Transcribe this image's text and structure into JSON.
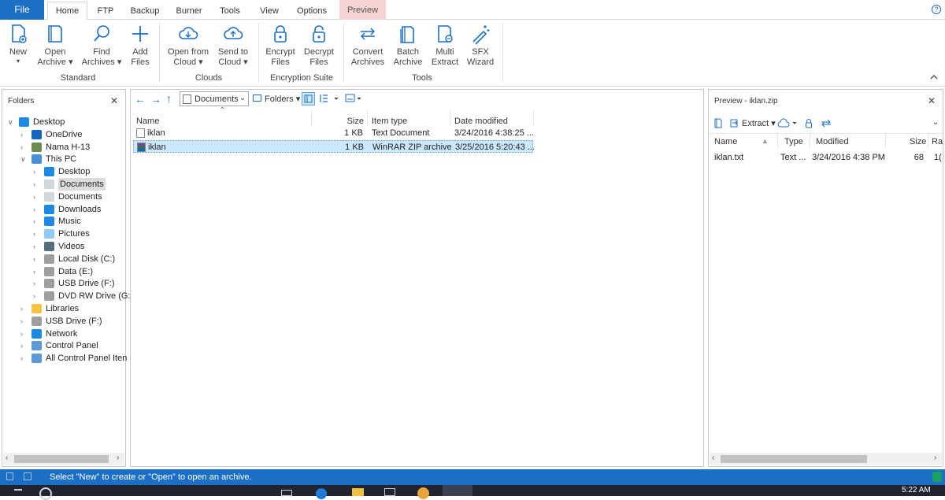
{
  "tabs": {
    "file": "File",
    "home": "Home",
    "ftp": "FTP",
    "backup": "Backup",
    "burner": "Burner",
    "tools": "Tools",
    "view": "View",
    "options": "Options",
    "preview": "Preview"
  },
  "help_icon": "?",
  "ribbon": {
    "new": {
      "line1": "New",
      "line2": "",
      "arrow": "▾"
    },
    "open_archive": {
      "line1": "Open",
      "line2": "Archive ▾"
    },
    "find_archives": {
      "line1": "Find",
      "line2": "Archives ▾"
    },
    "add_files": {
      "line1": "Add",
      "line2": "Files"
    },
    "open_from_cloud": {
      "line1": "Open from",
      "line2": "Cloud ▾"
    },
    "send_to_cloud": {
      "line1": "Send to",
      "line2": "Cloud ▾"
    },
    "encrypt_files": {
      "line1": "Encrypt",
      "line2": "Files"
    },
    "decrypt_files": {
      "line1": "Decrypt",
      "line2": "Files"
    },
    "convert_archives": {
      "line1": "Convert",
      "line2": "Archives"
    },
    "batch_archive": {
      "line1": "Batch",
      "line2": "Archive"
    },
    "multi_extract": {
      "line1": "Multi",
      "line2": "Extract"
    },
    "sfx_wizard": {
      "line1": "SFX",
      "line2": "Wizard"
    },
    "groups": {
      "standard": "Standard",
      "clouds": "Clouds",
      "encryption": "Encryption Suite",
      "tools": "Tools"
    }
  },
  "folders_panel": {
    "title": "Folders",
    "close": "✕",
    "tree": [
      {
        "label": "Desktop",
        "chev": "∨",
        "icon": "desktop-icon"
      },
      {
        "label": "OneDrive",
        "chev": "›",
        "icon": "cloud-icon"
      },
      {
        "label": "Nama H-13",
        "chev": "›",
        "icon": "user-icon"
      },
      {
        "label": "This PC",
        "chev": "∨",
        "icon": "computer-icon"
      },
      {
        "label": "Desktop",
        "chev": "›",
        "icon": "desktop-icon"
      },
      {
        "label": "Documents",
        "chev": "›",
        "icon": "documents-icon"
      },
      {
        "label": "Documents",
        "chev": "›",
        "icon": "documents-icon"
      },
      {
        "label": "Downloads",
        "chev": "›",
        "icon": "download-icon"
      },
      {
        "label": "Music",
        "chev": "›",
        "icon": "music-icon"
      },
      {
        "label": "Pictures",
        "chev": "›",
        "icon": "pictures-icon"
      },
      {
        "label": "Videos",
        "chev": "›",
        "icon": "videos-icon"
      },
      {
        "label": "Local Disk (C:)",
        "chev": "›",
        "icon": "drive-icon"
      },
      {
        "label": "Data (E:)",
        "chev": "›",
        "icon": "drive-icon"
      },
      {
        "label": "USB Drive (F:)",
        "chev": "›",
        "icon": "usb-drive-icon"
      },
      {
        "label": "DVD RW Drive (G:",
        "chev": "›",
        "icon": "dvd-drive-icon"
      },
      {
        "label": "Libraries",
        "chev": "›",
        "icon": "libraries-icon"
      },
      {
        "label": "USB Drive (F:)",
        "chev": "›",
        "icon": "usb-drive-icon"
      },
      {
        "label": "Network",
        "chev": "›",
        "icon": "network-icon"
      },
      {
        "label": "Control Panel",
        "chev": "›",
        "icon": "control-panel-icon"
      },
      {
        "label": "All Control Panel Iten",
        "chev": "›",
        "icon": "control-panel-icon"
      }
    ]
  },
  "file_pane": {
    "nav": {
      "back": "←",
      "forward": "→",
      "up": "↑"
    },
    "address": "Documents",
    "folders_btn": "Folders ▾",
    "columns": {
      "name": "Name",
      "size": "Size",
      "type": "Item type",
      "date": "Date modified"
    },
    "sort_arrow": "⌃",
    "rows": [
      {
        "name": "iklan",
        "size": "1 KB",
        "type": "Text Document",
        "date": "3/24/2016 4:38:25 ...",
        "icon": "text-file-icon"
      },
      {
        "name": "iklan",
        "size": "1 KB",
        "type": "WinRAR ZIP archive",
        "date": "3/25/2016 5:20:43 ...",
        "icon": "winrar-archive-icon"
      }
    ]
  },
  "preview_pane": {
    "title": "Preview - iklan.zip",
    "close": "✕",
    "extract_btn": "Extract ▾",
    "columns": {
      "name": "Name",
      "type": "Type",
      "modified": "Modified",
      "size": "Size",
      "ratio": "Ra"
    },
    "rows": [
      {
        "name": "iklan.txt",
        "type": "Text ...",
        "modified": "3/24/2016 4:38 PM",
        "size": "68",
        "ratio": "1("
      }
    ]
  },
  "status": {
    "message": "Select \"New\" to create or \"Open\" to open an archive."
  },
  "taskbar": {
    "time": "5:22 AM"
  },
  "colors": {
    "accent": "#1c6fc7",
    "preview_tab": "#f8d3d3",
    "selection": "#cce8ff"
  }
}
